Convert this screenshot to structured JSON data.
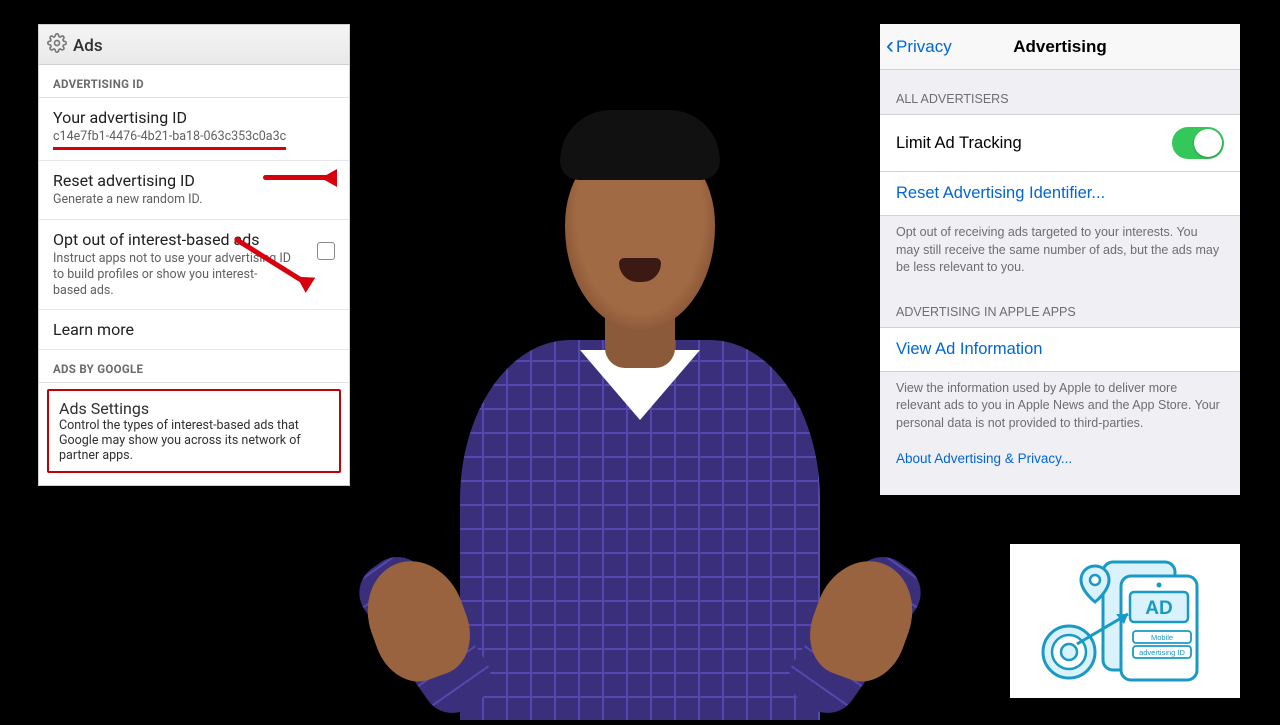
{
  "android": {
    "title": "Ads",
    "section_advertising_id": "ADVERTISING ID",
    "your_ad_id_label": "Your advertising ID",
    "your_ad_id_value": "c14e7fb1-4476-4b21-ba18-063c353c0a3c",
    "reset_label": "Reset advertising ID",
    "reset_sub": "Generate a new random ID.",
    "optout_label": "Opt out of interest-based ads",
    "optout_sub": "Instruct apps not to use your advertising ID to build profiles or show you interest-based ads.",
    "learn_more": "Learn more",
    "section_ads_by_google": "ADS BY GOOGLE",
    "ads_settings_label": "Ads Settings",
    "ads_settings_sub": "Control the types of interest-based ads that Google may show you across its network of partner apps."
  },
  "ios": {
    "back_label": "Privacy",
    "title": "Advertising",
    "group_all_advertisers": "ALL ADVERTISERS",
    "limit_tracking": "Limit Ad Tracking",
    "reset_identifier": "Reset Advertising Identifier...",
    "optout_footer": "Opt out of receiving ads targeted to your interests. You may still receive the same number of ads, but the ads may be less relevant to you.",
    "group_apple_apps": "ADVERTISING IN APPLE APPS",
    "view_ad_info": "View Ad Information",
    "view_footer": "View the information used by Apple to deliver more relevant ads to you in Apple News and the App Store. Your personal data is not provided to third-parties.",
    "about_link": "About Advertising & Privacy..."
  },
  "illus": {
    "ad_text": "AD",
    "tag1": "Mobile",
    "tag2": "advertising ID"
  }
}
